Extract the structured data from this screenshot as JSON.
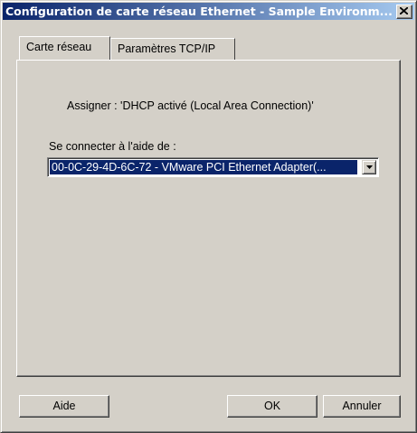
{
  "window": {
    "title": "Configuration de carte réseau Ethernet - Sample Environm..."
  },
  "tabs": [
    {
      "label": "Carte réseau",
      "active": true
    },
    {
      "label": "Paramètres TCP/IP",
      "active": false
    }
  ],
  "panel": {
    "assign_text": "Assigner : 'DHCP activé (Local Area Connection)'",
    "connect_label": "Se connecter à l'aide de :",
    "adapter_select": {
      "value": "00-0C-29-4D-6C-72 - VMware PCI Ethernet Adapter(..."
    }
  },
  "buttons": {
    "help": "Aide",
    "ok": "OK",
    "cancel": "Annuler"
  },
  "icons": {
    "close": "close-icon",
    "dropdown": "chevron-down-icon"
  },
  "colors": {
    "face": "#d4d0c8",
    "title_start": "#0a246a",
    "title_end": "#a6caf0",
    "selection": "#0a246a"
  }
}
